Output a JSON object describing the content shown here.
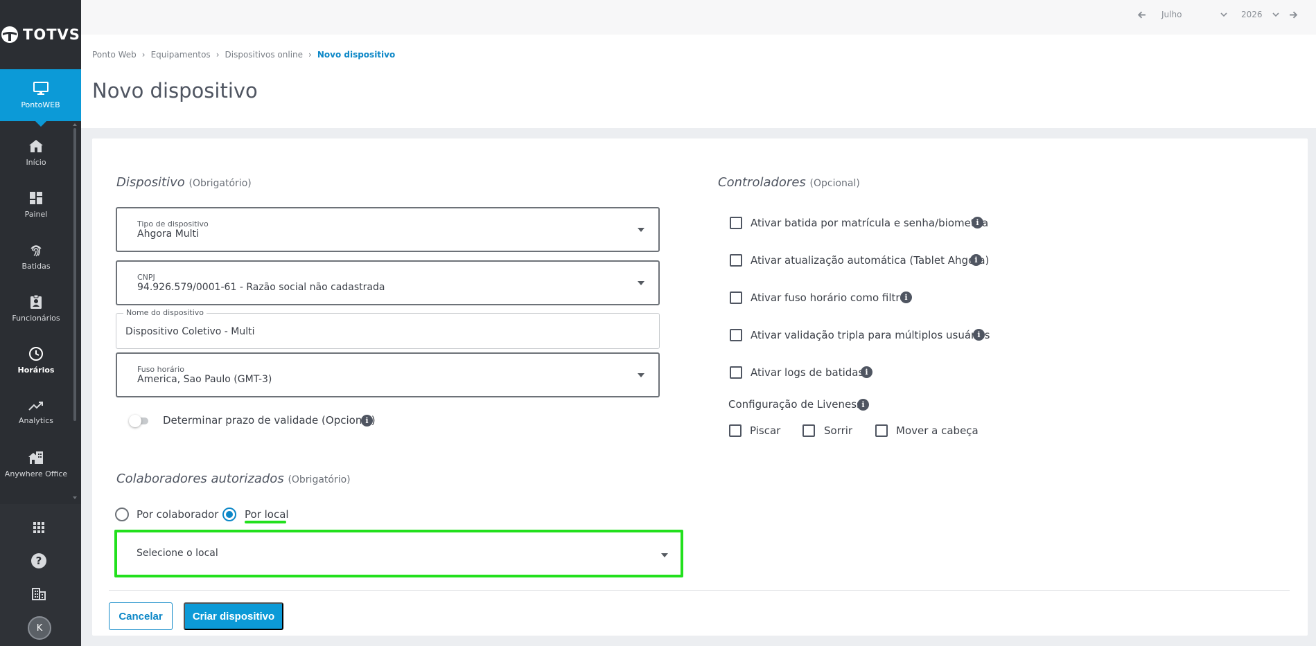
{
  "brand": {
    "name": "TOTVS"
  },
  "sidebar": {
    "app": {
      "label": "PontoWEB",
      "icon": "monitor-icon"
    },
    "items": [
      {
        "label": "Início",
        "icon": "home-icon"
      },
      {
        "label": "Painel",
        "icon": "dashboard-icon"
      },
      {
        "label": "Batidas",
        "icon": "fingerprint-icon"
      },
      {
        "label": "Funcionários",
        "icon": "badge-icon"
      },
      {
        "label": "Horários",
        "icon": "clock-icon"
      },
      {
        "label": "Analytics",
        "icon": "trending-up-icon"
      },
      {
        "label": "Anywhere Office",
        "icon": "home-work-icon"
      }
    ],
    "bottom": {
      "avatar_initial": "K"
    }
  },
  "topbar": {
    "month": "Julho",
    "year": "2026"
  },
  "breadcrumb": [
    "Ponto Web",
    "Equipamentos",
    "Dispositivos online",
    "Novo dispositivo"
  ],
  "page_title": "Novo dispositivo",
  "dispositivo": {
    "title": "Dispositivo",
    "qualifier": "(Obrigatório)",
    "tipo": {
      "label": "Tipo de dispositivo",
      "value": "Ahgora Multi"
    },
    "cnpj": {
      "label": "CNPJ",
      "value": "94.926.579/0001-61 - Razão social não cadastrada"
    },
    "nome": {
      "label": "Nome do dispositivo",
      "value": "Dispositivo Coletivo - Multi"
    },
    "fuso": {
      "label": "Fuso horário",
      "value": "America, Sao Paulo (GMT-3)"
    },
    "validade": {
      "label": "Determinar prazo de validade (Opcional)"
    }
  },
  "colaboradores": {
    "title": "Colaboradores autorizados",
    "qualifier": "(Obrigatório)",
    "options": [
      "Por colaborador",
      "Por local"
    ],
    "selected": "Por local",
    "select_placeholder": "Selecione o local"
  },
  "controladores": {
    "title": "Controladores",
    "qualifier": "(Opcional)",
    "options": [
      "Ativar batida por matrícula e senha/biometria",
      "Ativar atualização automática (Tablet Ahgora)",
      "Ativar fuso horário como filtro",
      "Ativar validação tripla para múltiplos usuários",
      "Ativar logs de batidas"
    ],
    "liveness": {
      "label": "Configuração de Liveness",
      "options": [
        "Piscar",
        "Sorrir",
        "Mover a cabeça"
      ]
    }
  },
  "actions": {
    "cancel": "Cancelar",
    "create": "Criar dispositivo"
  },
  "colors": {
    "primary": "#0c9ad7",
    "sidebar": "#2b2e33",
    "highlight": "#22e01d"
  }
}
